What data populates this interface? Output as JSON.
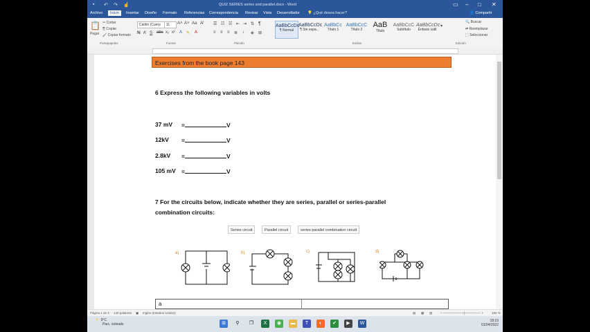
{
  "window": {
    "title": "QUIZ SERIES series and parallel.docx - Word",
    "quick_access": [
      "save",
      "undo",
      "redo",
      "touch"
    ]
  },
  "tabs": [
    {
      "label": "Archivo",
      "active": false
    },
    {
      "label": "Inicio",
      "active": true
    },
    {
      "label": "Insertar",
      "active": false
    },
    {
      "label": "Diseño",
      "active": false
    },
    {
      "label": "Formato",
      "active": false
    },
    {
      "label": "Referencias",
      "active": false
    },
    {
      "label": "Correspondencia",
      "active": false
    },
    {
      "label": "Revisar",
      "active": false
    },
    {
      "label": "Vista",
      "active": false
    },
    {
      "label": "Desarrollador",
      "active": false
    }
  ],
  "tell_me": "¿Qué desea hacer?",
  "share": "Compartir",
  "ribbon": {
    "paste": "Pegar",
    "cut": "Cortar",
    "copy": "Copiar",
    "format_painter": "Copiar formato",
    "font_name": "Calibri (Cuerp",
    "font_size": "11",
    "styles": [
      {
        "preview": "AaBbCcDc",
        "name": "¶ Normal",
        "active": true
      },
      {
        "preview": "AaBbCcDc",
        "name": "¶ Sin espa...",
        "active": false
      },
      {
        "preview": "AaBbCc",
        "name": "Título 1",
        "active": false
      },
      {
        "preview": "AaBbCcC",
        "name": "Título 2",
        "active": false
      },
      {
        "preview": "AaB",
        "name": "Título",
        "active": false
      },
      {
        "preview": "AaBbCcC",
        "name": "Subtítulo",
        "active": false
      },
      {
        "preview": "AaBbCcDc",
        "name": "Énfasis sutil",
        "active": false
      }
    ],
    "find": "Buscar",
    "replace": "Reemplazar",
    "select": "Seleccionar",
    "groups": [
      "Portapapeles",
      "Fuente",
      "Párrafo",
      "Estilos",
      "Edición"
    ]
  },
  "document": {
    "banner": "Exercises from the book page 143",
    "q6": "6 Express the following variables in volts",
    "rows": [
      {
        "value": "37 mV",
        "eq": "=",
        "unit": "V"
      },
      {
        "value": "12kV",
        "eq": "=",
        "unit": "V"
      },
      {
        "value": "2.8kV",
        "eq": "=",
        "unit": "V"
      },
      {
        "value": "105 mV",
        "eq": "=",
        "unit": "V"
      }
    ],
    "q7_line1": "7 For the circuits below, indicate whether they are series, parallel or series-parallel",
    "q7_line2": "combination circuits:",
    "options": [
      "Series circuit",
      "Parallel circuit",
      "series-parallel combination circuit"
    ],
    "circuit_labels": [
      "a)",
      "b)",
      "c)",
      "d)"
    ],
    "answer_cell": "a"
  },
  "status": {
    "page": "Página 1 de 2",
    "words": "140 palabras",
    "language": "Inglés (Estados Unidos)",
    "zoom": "160 %"
  },
  "taskbar": {
    "temperature": "9°C",
    "weather": "Parc. soleado",
    "time": "18:15",
    "date": "01/04/2022"
  }
}
